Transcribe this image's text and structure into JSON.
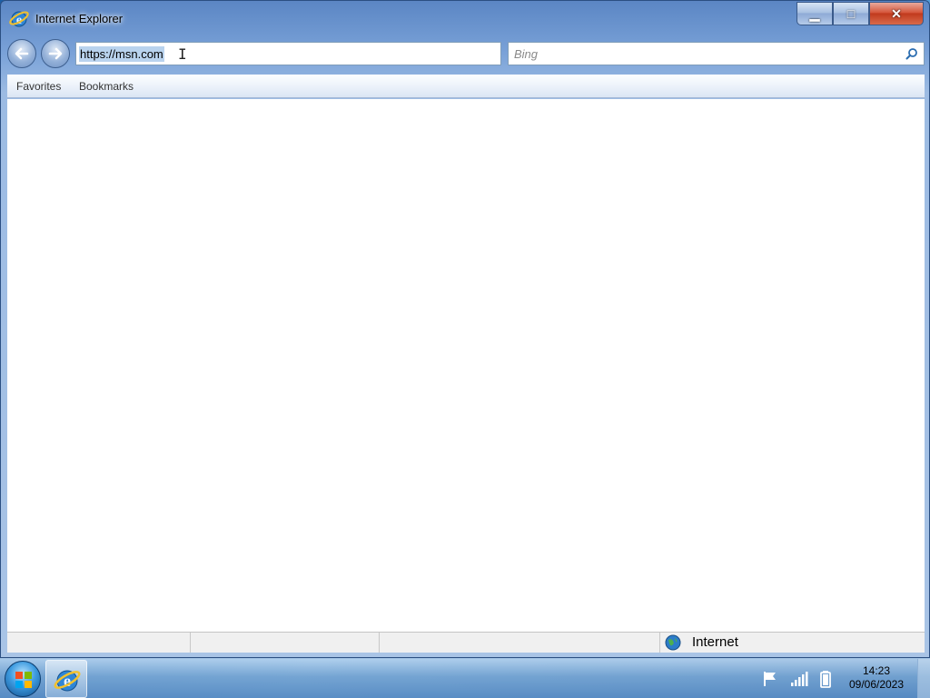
{
  "window": {
    "title": "Internet Explorer",
    "minimize_glyph": "▁",
    "maximize_glyph": "□",
    "close_glyph": "✕"
  },
  "address": {
    "value": "https://msn.com"
  },
  "search": {
    "placeholder": "Bing"
  },
  "favorites_bar": {
    "items": [
      {
        "label": "Favorites"
      },
      {
        "label": "Bookmarks"
      }
    ]
  },
  "status_bar": {
    "zone": "Internet"
  },
  "taskbar": {
    "clock_time": "14:23",
    "clock_date": "09/06/2023"
  },
  "icons": {
    "app": "internet-explorer-icon",
    "back": "back-arrow-icon",
    "forward": "forward-arrow-icon",
    "search": "search-icon",
    "zone": "globe-icon",
    "start": "windows-start-icon",
    "flag": "action-center-flag-icon",
    "signal": "network-signal-icon",
    "battery": "battery-icon"
  },
  "colors": {
    "selection": "#b9d3ee",
    "close_button": "#c13a1d",
    "frame": "#7aa2d8"
  }
}
